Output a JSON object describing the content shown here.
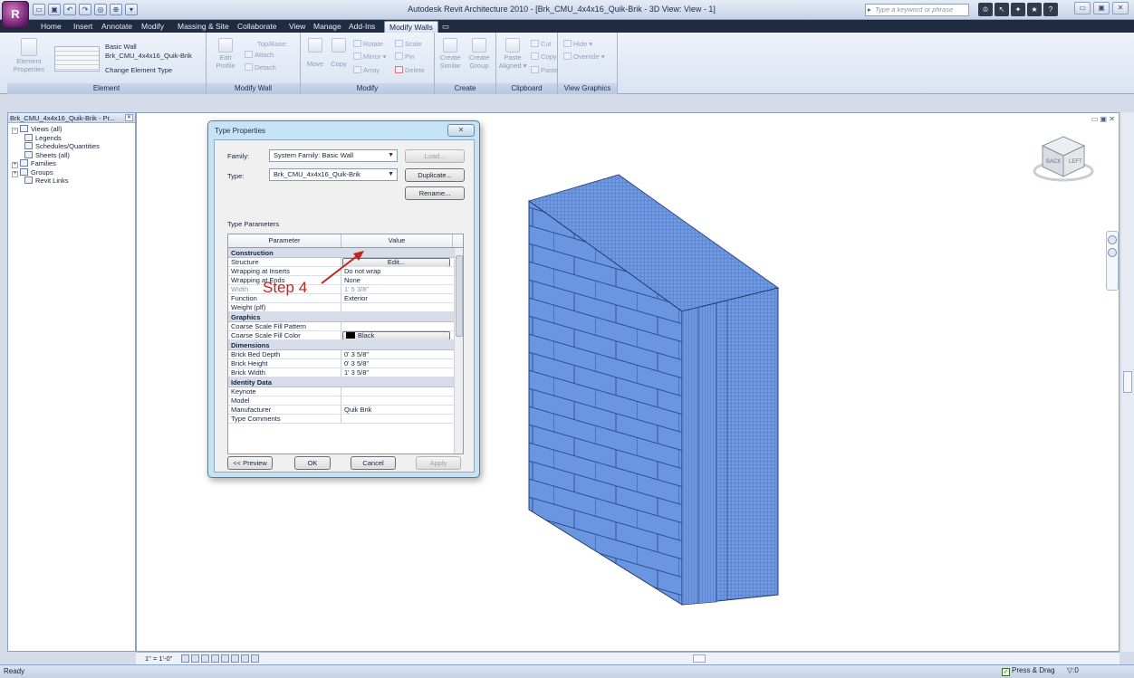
{
  "app": {
    "logo_letter": "R",
    "window_title": "Autodesk Revit Architecture 2010 - [Brk_CMU_4x4x16_Quik-Brik - 3D View: View - 1]",
    "search_placeholder": "Type a keyword or phrase",
    "qat": [
      "▭",
      "▣",
      "↶",
      "↷",
      "◎",
      "⊕",
      "▾"
    ],
    "help_tools": [
      "♔",
      "↖",
      "✦",
      "★",
      "?"
    ],
    "window_controls": [
      "▭",
      "▣",
      "✕"
    ]
  },
  "ribbon_tabs": [
    {
      "label": "Home",
      "active": false
    },
    {
      "label": "Insert",
      "active": false
    },
    {
      "label": "Annotate",
      "active": false
    },
    {
      "label": "Modify",
      "active": false
    },
    {
      "label": "Massing & Site",
      "active": false
    },
    {
      "label": "Collaborate",
      "active": false
    },
    {
      "label": "View",
      "active": false
    },
    {
      "label": "Manage",
      "active": false
    },
    {
      "label": "Add-Ins",
      "active": false
    },
    {
      "label": "Modify Walls",
      "active": true
    },
    {
      "label": "▭",
      "active": false
    }
  ],
  "ribbon": {
    "element": {
      "title": "Element",
      "properties_btn": "Element Properties",
      "type_line1": "Basic Wall",
      "type_line2": "Brk_CMU_4x4x16_Quik-Brik",
      "change_type": "Change Element Type"
    },
    "modify_wall": {
      "title": "Modify Wall",
      "edit_profile": "Edit Profile",
      "top_base": "Top/Base:",
      "attach": "Attach",
      "detach": "Detach"
    },
    "modify": {
      "title": "Modify",
      "move": "Move",
      "copy": "Copy",
      "rotate": "Rotate",
      "scale": "Scale",
      "mirror": "Mirror ▾",
      "pin": "Pin",
      "array": "Array",
      "delete": "Delete"
    },
    "create": {
      "title": "Create",
      "create_similar": "Create Similar",
      "create_group": "Create Group"
    },
    "clipboard": {
      "title": "Clipboard",
      "paste_aligned": "Paste Aligned ▾",
      "cut": "Cut",
      "copy": "Copy",
      "paste": "Paste"
    },
    "view_graphics": {
      "title": "View Graphics",
      "hide": "Hide ▾",
      "override": "Override ▾"
    }
  },
  "browser": {
    "title": "Brk_CMU_4x4x16_Quik-Brik - Pr...",
    "items": [
      {
        "label": "Views (all)",
        "indent": 0,
        "expander": "⊟"
      },
      {
        "label": "Legends",
        "indent": 1,
        "expander": ""
      },
      {
        "label": "Schedules/Quantities",
        "indent": 1,
        "expander": ""
      },
      {
        "label": "Sheets (all)",
        "indent": 1,
        "expander": ""
      },
      {
        "label": "Families",
        "indent": 0,
        "expander": "⊞"
      },
      {
        "label": "Groups",
        "indent": 0,
        "expander": "⊞"
      },
      {
        "label": "Revit Links",
        "indent": 1,
        "expander": ""
      }
    ]
  },
  "canvas": {
    "view_controls": "▭ ▣ ✕",
    "viewcube_back": "BACK",
    "viewcube_left": "LEFT",
    "wall_color": "#6a95e0"
  },
  "view_bar": {
    "scale": "1\" = 1'-0\""
  },
  "status": {
    "text": "Ready",
    "press_drag": "Press & Drag",
    "filter": ":0"
  },
  "dialog": {
    "title": "Type Properties",
    "close": "✕",
    "family_label": "Family:",
    "family_value": "System Family: Basic Wall",
    "type_label": "Type:",
    "type_value": "Brk_CMU_4x4x16_Quik-Brik",
    "load_btn": "Load...",
    "duplicate_btn": "Duplicate...",
    "rename_btn": "Rename...",
    "type_parameters_label": "Type Parameters",
    "col_parameter": "Parameter",
    "col_value": "Value",
    "sections": [
      {
        "name": "Construction",
        "rows": [
          {
            "param": "Structure",
            "value": "Edit...",
            "button": true,
            "muted": false
          },
          {
            "param": "Wrapping at Inserts",
            "value": "Do not wrap",
            "button": false,
            "muted": false
          },
          {
            "param": "Wrapping at Ends",
            "value": "None",
            "button": false,
            "muted": false
          },
          {
            "param": "Width",
            "value": "1'  5 3/8\"",
            "button": false,
            "muted": true
          },
          {
            "param": "Function",
            "value": "Exterior",
            "button": false,
            "muted": false
          },
          {
            "param": "Weight (plf)",
            "value": "",
            "button": false,
            "muted": false
          }
        ]
      },
      {
        "name": "Graphics",
        "rows": [
          {
            "param": "Coarse Scale Fill Pattern",
            "value": "",
            "button": false,
            "muted": false
          },
          {
            "param": "Coarse Scale Fill Color",
            "value": "Black",
            "button": true,
            "swatch": true,
            "muted": false
          }
        ]
      },
      {
        "name": "Dimensions",
        "rows": [
          {
            "param": "Brick Bed Depth",
            "value": "0'  3 5/8\"",
            "button": false,
            "muted": false
          },
          {
            "param": "Brick Height",
            "value": "0'  3 5/8\"",
            "button": false,
            "muted": false
          },
          {
            "param": "Brick Width",
            "value": "1'  3 5/8\"",
            "button": false,
            "muted": false
          }
        ]
      },
      {
        "name": "Identity Data",
        "rows": [
          {
            "param": "Keynote",
            "value": "",
            "button": false,
            "muted": false
          },
          {
            "param": "Model",
            "value": "",
            "button": false,
            "muted": false
          },
          {
            "param": "Manufacturer",
            "value": "Quik Brik",
            "button": false,
            "muted": false
          },
          {
            "param": "Type Comments",
            "value": "",
            "button": false,
            "muted": false
          }
        ]
      }
    ],
    "preview_btn": "<< Preview",
    "ok_btn": "OK",
    "cancel_btn": "Cancel",
    "apply_btn": "Apply"
  },
  "annotation": {
    "text": "Step 4",
    "color": "#c0261e"
  }
}
